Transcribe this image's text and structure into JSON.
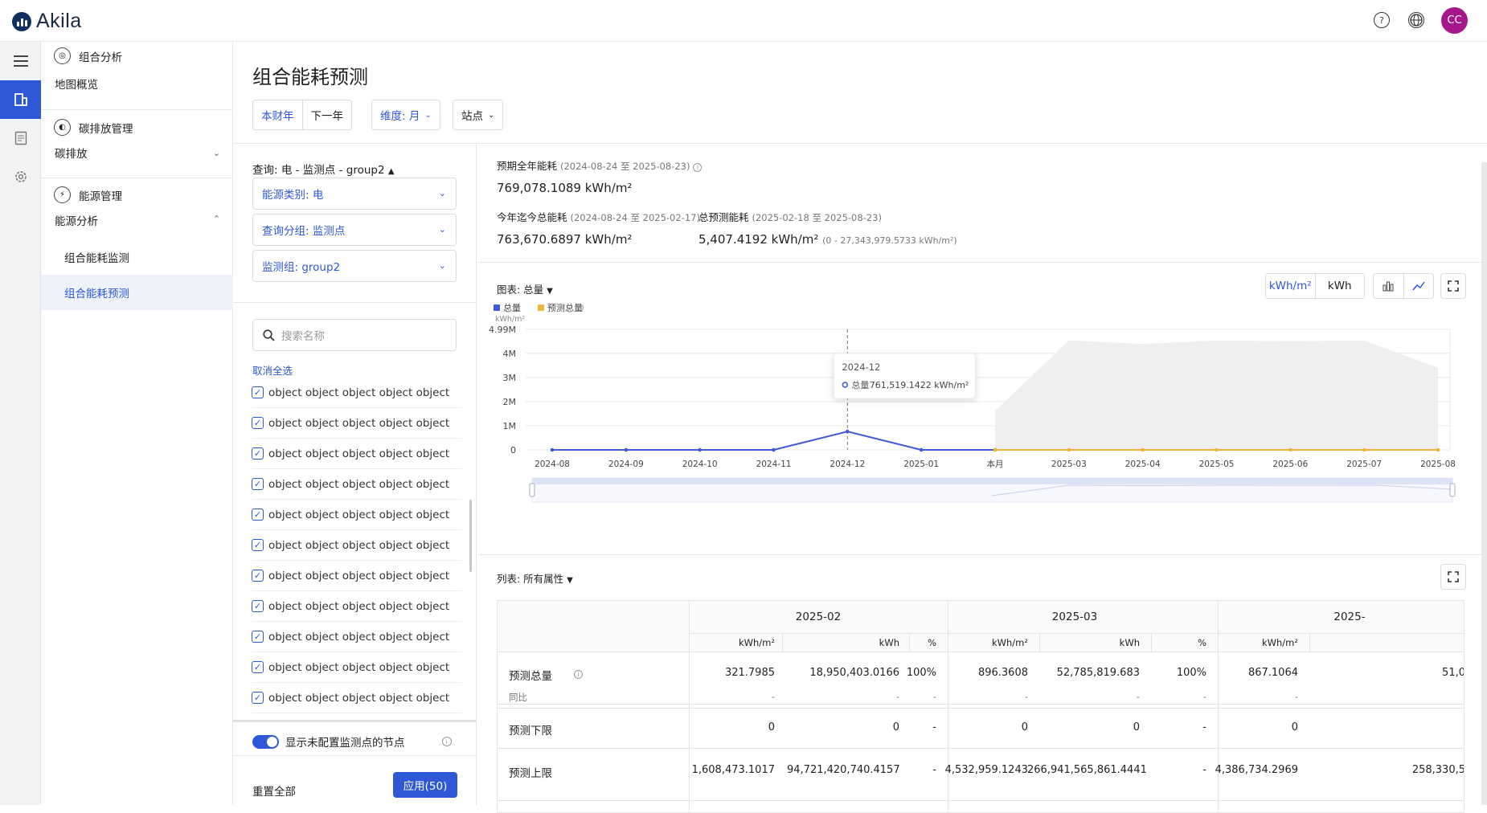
{
  "app": {
    "logo_text": "Akila",
    "avatar_initials": "CC",
    "accent": "#2e58d6"
  },
  "header": {
    "icons": [
      "help-icon",
      "globe-icon"
    ]
  },
  "sidebar": {
    "sections": [
      {
        "title": "组合分析",
        "items": [
          "地图概览"
        ]
      },
      {
        "title": "碳排放管理",
        "items": [
          "碳排放"
        ]
      },
      {
        "title": "能源管理",
        "items": [
          "能源分析"
        ]
      }
    ],
    "sub_items": [
      "组合能耗监测",
      "组合能耗预测"
    ]
  },
  "page": {
    "title": "组合能耗预测",
    "year_tabs": [
      "本财年",
      "下一年"
    ],
    "dimension": "维度: 月",
    "site": "站点"
  },
  "filter": {
    "query": "查询: 电 - 监测点 - group2",
    "energy_type": "能源类别: 电",
    "query_group": "查询分组: 监测点",
    "monitor_group": "监测组: group2",
    "search_placeholder": "搜索名称",
    "cancel_all": "取消全选",
    "items": [
      "object object object object object",
      "object object object object object",
      "object object object object object",
      "object object object object object",
      "object object object object object",
      "object object object object object",
      "object object object object object",
      "object object object object object",
      "object object object object object",
      "object object object object object",
      "object object object object object",
      "object object object object object"
    ],
    "toggle_label": "显示未配置监测点的节点",
    "reset": "重置全部",
    "apply": "应用(50)"
  },
  "stats": {
    "annual_label": "预期全年能耗",
    "annual_range": "(2024-08-24 至 2025-08-23)",
    "annual_value": "769,078.1089 kWh/m²",
    "ytd_label": "今年迄今总能耗",
    "ytd_range": "(2024-08-24 至 2025-02-17)",
    "ytd_value": "763,670.6897 kWh/m²",
    "forecast_label": "总预测能耗",
    "forecast_range": "(2025-02-18 至 2025-08-23)",
    "forecast_value": "5,407.4192 kWh/m²",
    "forecast_bounds": "(0 - 27,343,979.5733 kWh/m²)"
  },
  "chart_toolbar": {
    "label": "图表: 总量",
    "unit_a": "kWh/m²",
    "unit_b": "kWh"
  },
  "chart_data": {
    "type": "line",
    "y_unit": "kWh/m²",
    "x": [
      "2024-08",
      "2024-09",
      "2024-10",
      "2024-11",
      "2024-12",
      "2025-01",
      "本月",
      "2025-03",
      "2025-04",
      "2025-05",
      "2025-06",
      "2025-07",
      "2025-08"
    ],
    "y_ticks": [
      "0",
      "1M",
      "2M",
      "3M",
      "4M",
      "4.99M"
    ],
    "ylim": [
      0,
      4990000
    ],
    "series": [
      {
        "name": "总量",
        "color": "#3f5bd6",
        "values": [
          0,
          0,
          0,
          0,
          761519.1422,
          0,
          0,
          null,
          null,
          null,
          null,
          null,
          null
        ]
      },
      {
        "name": "预测总量",
        "color": "#f0b43c",
        "values": [
          null,
          null,
          null,
          null,
          null,
          null,
          0,
          0,
          0,
          0,
          0,
          0,
          0
        ]
      }
    ],
    "forecast_band_upper": [
      null,
      null,
      null,
      null,
      null,
      null,
      1608473,
      4532959,
      4386734,
      4532959,
      4500000,
      4532959,
      3400000
    ],
    "tooltip": {
      "title": "2024-12",
      "series": "总量",
      "value": "761,519.1422 kWh/m²"
    },
    "legend": "top-left"
  },
  "table": {
    "label": "列表: 所有属性",
    "months": [
      "2025-02",
      "2025-03",
      "2025-"
    ],
    "units": [
      "kWh/m²",
      "kWh",
      "%",
      "kWh/m²",
      "kWh",
      "%",
      "kWh/m²"
    ],
    "rows": [
      {
        "name": "预测总量",
        "cells": [
          "321.7985",
          "18,950,403.0166",
          "100%",
          "896.3608",
          "52,785,819.683",
          "100%",
          "867.1064",
          "51,0"
        ]
      },
      {
        "name": "同比",
        "cells": [
          "-",
          "-",
          "-",
          "-",
          "-",
          "-",
          "-",
          ""
        ]
      },
      {
        "name": "预测下限",
        "cells": [
          "0",
          "0",
          "-",
          "0",
          "0",
          "-",
          "0",
          ""
        ]
      },
      {
        "name": "预测上限",
        "cells": [
          "1,608,473.1017",
          "94,721,420,740.4157",
          "-",
          "4,532,959.1243",
          "266,941,565,861.4441",
          "-",
          "4,386,734.2969",
          "258,330,5"
        ]
      }
    ]
  }
}
